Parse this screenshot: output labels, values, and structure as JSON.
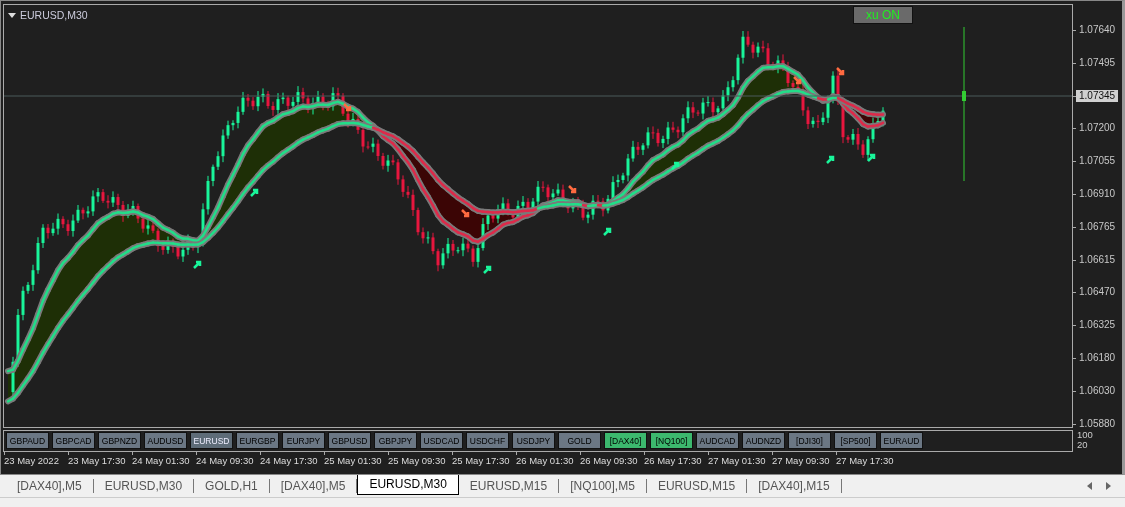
{
  "chart": {
    "title": "EURUSD,M30",
    "toggle": "xu ON",
    "price_axis": [
      "1.07640",
      "1.07495",
      "1.07200",
      "1.07055",
      "1.06910",
      "1.06765",
      "1.06615",
      "1.06470",
      "1.06325",
      "1.06180",
      "1.06030",
      "1.05880"
    ],
    "current_price": "1.07345",
    "symbol_buttons": [
      {
        "label": "GBPAUD",
        "kind": "normal"
      },
      {
        "label": "GBPCAD",
        "kind": "normal"
      },
      {
        "label": "GBPNZD",
        "kind": "normal"
      },
      {
        "label": "AUDUSD",
        "kind": "normal"
      },
      {
        "label": "EURUSD",
        "kind": "current"
      },
      {
        "label": "EURGBP",
        "kind": "normal"
      },
      {
        "label": "EURJPY",
        "kind": "normal"
      },
      {
        "label": "GBPUSD",
        "kind": "normal"
      },
      {
        "label": "GBPJPY",
        "kind": "normal"
      },
      {
        "label": "USDCAD",
        "kind": "normal"
      },
      {
        "label": "USDCHF",
        "kind": "normal"
      },
      {
        "label": "USDJPY",
        "kind": "normal"
      },
      {
        "label": "GOLD",
        "kind": "normal"
      },
      {
        "label": "[DAX40]",
        "kind": "active"
      },
      {
        "label": "[NQ100]",
        "kind": "active"
      },
      {
        "label": "AUDCAD",
        "kind": "normal"
      },
      {
        "label": "AUDNZD",
        "kind": "normal"
      },
      {
        "label": "[DJI30]",
        "kind": "normal"
      },
      {
        "label": "[SP500]",
        "kind": "normal"
      },
      {
        "label": "EURAUD",
        "kind": "normal"
      }
    ],
    "indicator_scale": [
      "100",
      "20"
    ],
    "time_axis": [
      "23 May 2022",
      "23 May 17:30",
      "24 May 01:30",
      "24 May 09:30",
      "24 May 17:30",
      "25 May 01:30",
      "25 May 09:30",
      "25 May 17:30",
      "26 May 01:30",
      "26 May 09:30",
      "26 May 17:30",
      "27 May 01:30",
      "27 May 09:30",
      "27 May 17:30"
    ]
  },
  "tabs": [
    {
      "label": "[DAX40],M5",
      "selected": false
    },
    {
      "label": "EURUSD,M30",
      "selected": false
    },
    {
      "label": "GOLD,H1",
      "selected": false
    },
    {
      "label": "[DAX40],M5",
      "selected": false
    },
    {
      "label": "EURUSD,M30",
      "selected": true
    },
    {
      "label": "EURUSD,M15",
      "selected": false
    },
    {
      "label": "[NQ100],M5",
      "selected": false
    },
    {
      "label": "EURUSD,M15",
      "selected": false
    },
    {
      "label": "[DAX40],M15",
      "selected": false
    }
  ]
}
